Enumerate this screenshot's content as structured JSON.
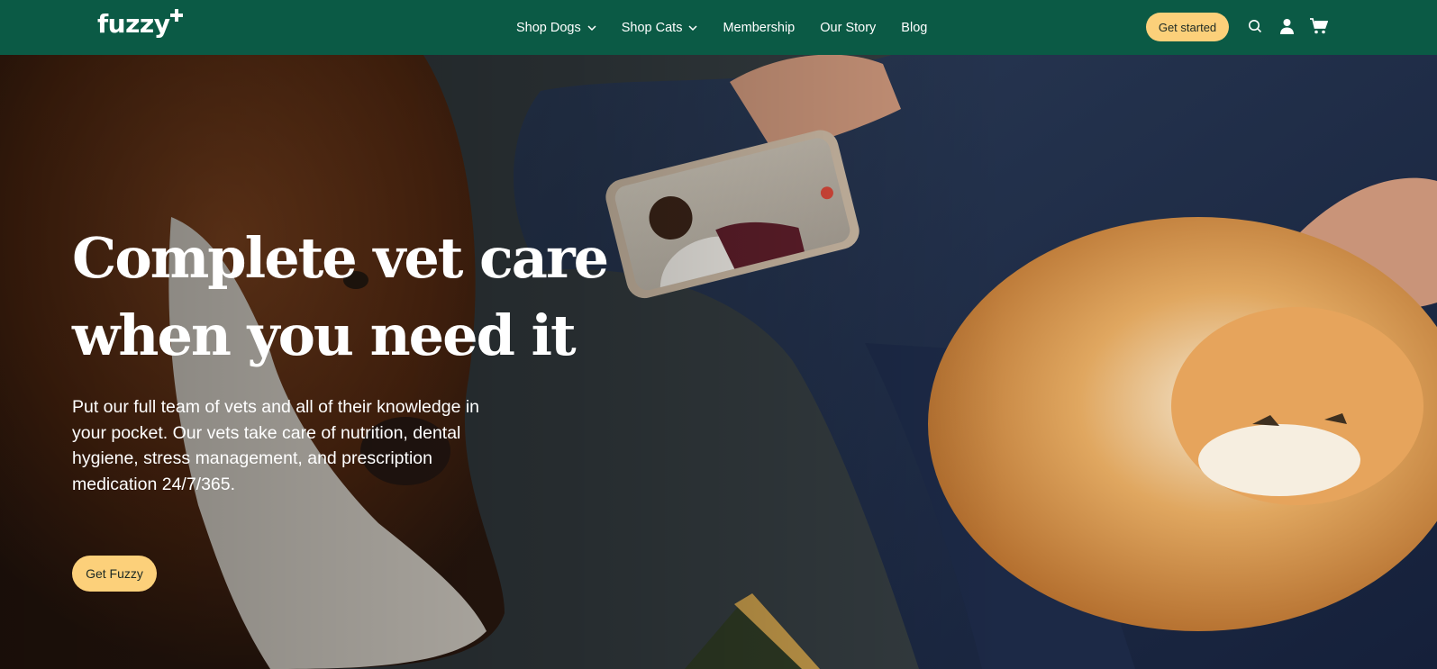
{
  "brand": {
    "logo_text": "fuzzy",
    "primary_color": "#0b5a45",
    "accent_color": "#fcd07a"
  },
  "nav": {
    "items": [
      {
        "label": "Shop Dogs",
        "has_dropdown": true
      },
      {
        "label": "Shop Cats",
        "has_dropdown": true
      },
      {
        "label": "Membership",
        "has_dropdown": false
      },
      {
        "label": "Our Story",
        "has_dropdown": false
      },
      {
        "label": "Blog",
        "has_dropdown": false
      }
    ],
    "cta_label": "Get started",
    "icons": [
      "search-icon",
      "user-icon",
      "cart-icon"
    ]
  },
  "hero": {
    "headline_line1": "Complete vet care",
    "headline_line2": "when you need it",
    "subtext": "Put our full team of vets and all of their knowledge in your pocket. Our vets take care of nutrition, dental hygiene, stress management, and prescription medication 24/7/365.",
    "cta_label": "Get Fuzzy"
  }
}
